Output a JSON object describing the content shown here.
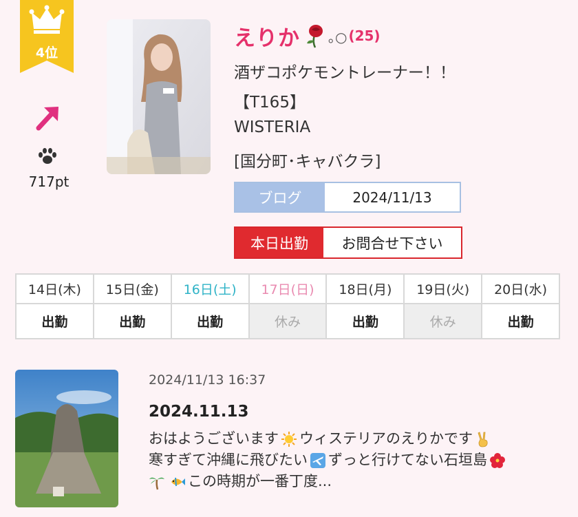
{
  "rank": {
    "label": "4位"
  },
  "points": "717pt",
  "profile": {
    "name": "えりか",
    "deco": "｡○",
    "age": "(25)",
    "catchphrase": "酒ザコポケモントレーナー！！",
    "height": "【T165】",
    "shop": "WISTERIA",
    "area": "[国分町･キャバクラ]"
  },
  "blog": {
    "label": "ブログ",
    "date": "2024/11/13"
  },
  "work": {
    "label": "本日出勤",
    "value": "お問合せ下さい"
  },
  "schedule": [
    {
      "day": "14日(木)",
      "status": "出勤"
    },
    {
      "day": "15日(金)",
      "status": "出勤"
    },
    {
      "day": "16日(土)",
      "status": "出勤"
    },
    {
      "day": "17日(日)",
      "status": "休み"
    },
    {
      "day": "18日(月)",
      "status": "出勤"
    },
    {
      "day": "19日(火)",
      "status": "休み"
    },
    {
      "day": "20日(水)",
      "status": "出勤"
    }
  ],
  "post": {
    "timestamp": "2024/11/13 16:37",
    "title": "2024.11.13",
    "line1a": "おはようございます",
    "line1b": "ウィステリアのえりかです",
    "line2a": "寒すぎて沖縄に飛びたい",
    "line2b": "ずっと行けてない石垣島",
    "line3": "この時期が一番丁度..."
  },
  "colors": {
    "accent": "#e5316b",
    "badge": "#f6c51f",
    "blog": "#a9c1e6",
    "work": "#e02a2f",
    "saturday": "#2fb3c7",
    "sunday": "#e98ab0"
  },
  "icons": [
    "crown-icon",
    "up-right-arrow-icon",
    "paw-icon",
    "rose-icon",
    "sun-icon",
    "victory-hand-icon",
    "airplane-icon",
    "hibiscus-icon",
    "palm-tree-icon",
    "tropical-fish-icon"
  ]
}
